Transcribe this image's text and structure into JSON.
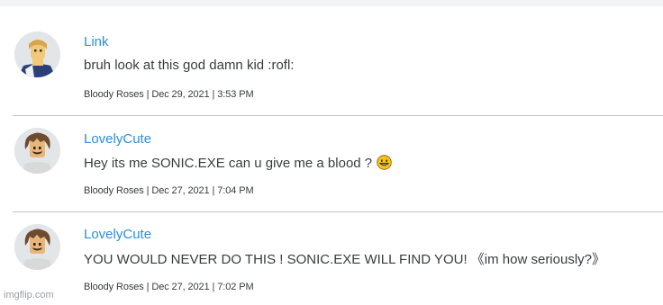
{
  "posts": [
    {
      "author": "Link",
      "message": "bruh look at this god damn kid :rofl:",
      "group": "Bloody Roses",
      "date": "Dec 29, 2021",
      "time": "3:53 PM",
      "avatar_icon": "blond-avatar-icon"
    },
    {
      "author": "LovelyCute",
      "message": "Hey its me SONIC.EXE can u give me a blood ?",
      "emoji": "grinning-face-icon",
      "group": "Bloody Roses",
      "date": "Dec 27, 2021",
      "time": "7:04 PM",
      "avatar_icon": "brown-hair-avatar-icon"
    },
    {
      "author": "LovelyCute",
      "message": "YOU WOULD NEVER DO THIS ! SONIC.EXE WILL FIND YOU! 《im how seriously?》",
      "group": "Bloody Roses",
      "date": "Dec 27, 2021",
      "time": "7:02 PM",
      "avatar_icon": "brown-hair-avatar-icon"
    }
  ],
  "meta_separator": " | ",
  "watermark": "imgflip.com",
  "colors": {
    "username": "#2a8ee0",
    "text": "#393b3d",
    "divider": "#c3c3c3"
  }
}
